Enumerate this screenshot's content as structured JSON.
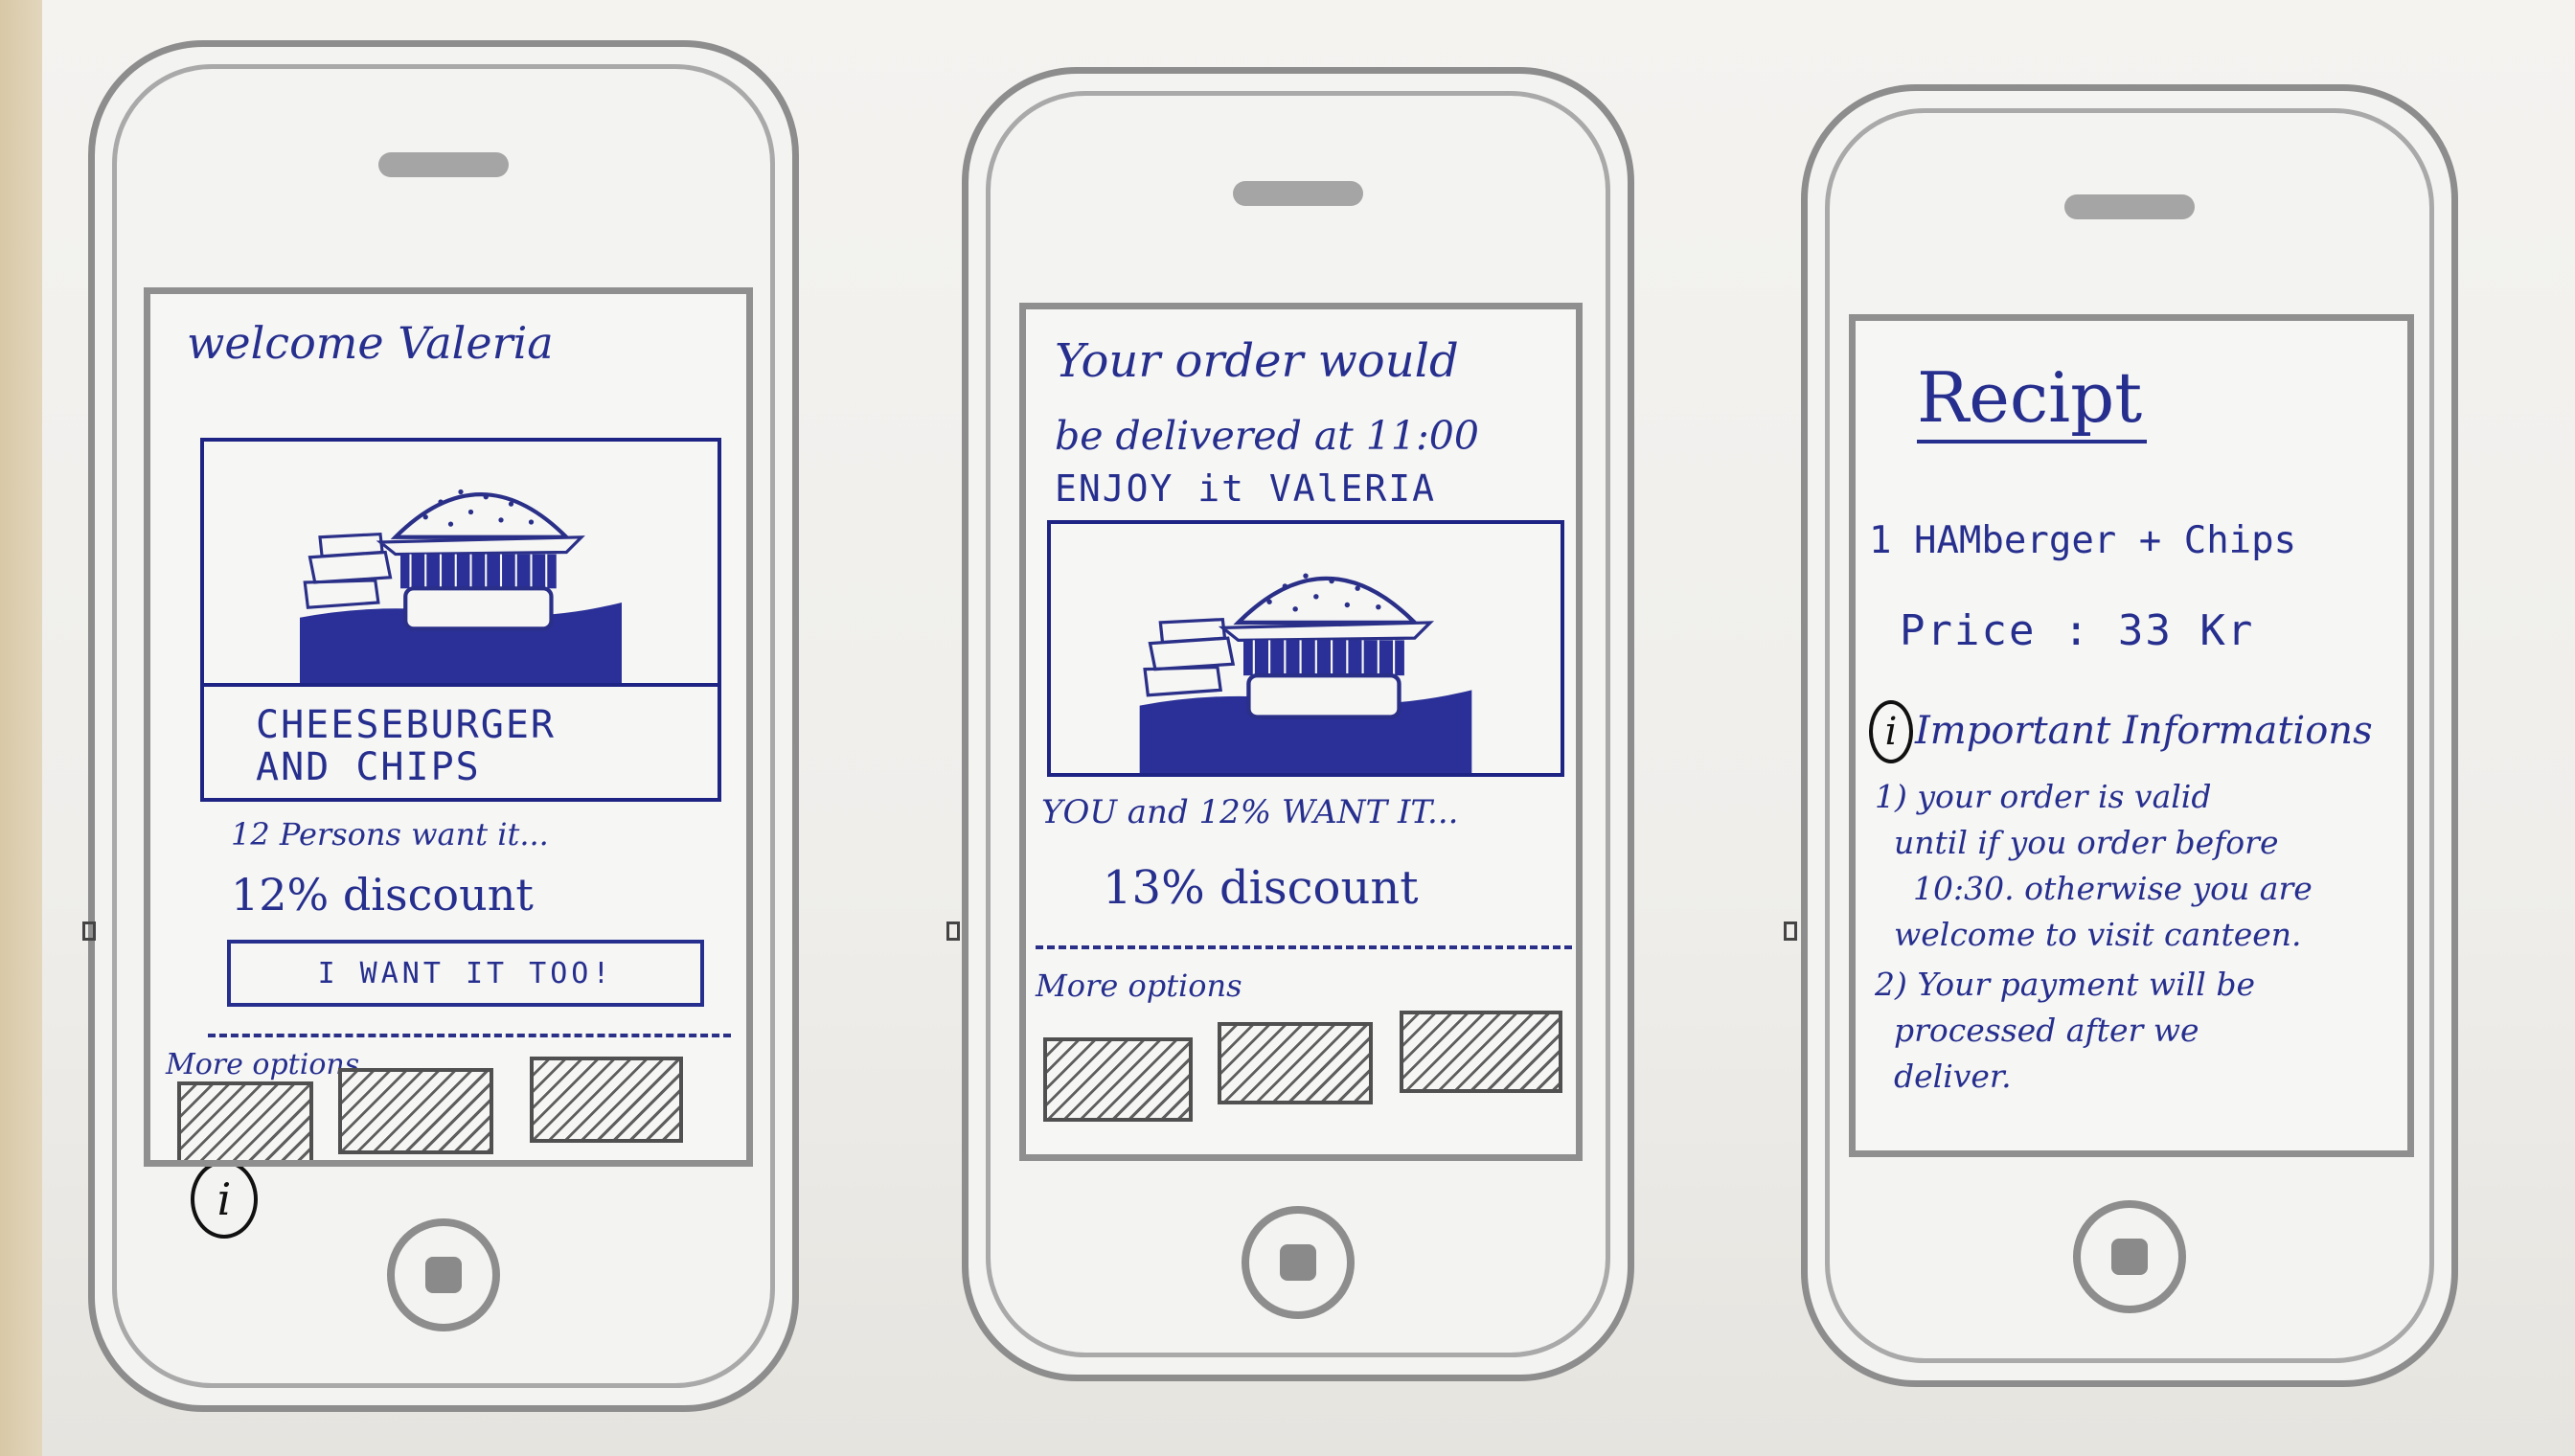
{
  "screen1": {
    "greeting": "welcome Valeria",
    "product_line1": "CHEESEBURGER",
    "product_line2": "AND CHIPS",
    "demand": "12 Persons want it...",
    "discount": "12% discount",
    "cta_button": "I WANT IT TOO!",
    "more_options": "More options",
    "info_icon": "i"
  },
  "screen2": {
    "line1": "Your order would",
    "line2": "be delivered at 11:00",
    "line3": "ENJOY it VAlERIA",
    "demand": "YOU and 12% WANT IT...",
    "discount": "13% discount",
    "more_options": "More options"
  },
  "screen3": {
    "title": "Recipt",
    "item": "1 HAMberger + Chips",
    "price": "Price : 33 Kr",
    "info_heading": "Important Informations",
    "info_icon": "i",
    "note1_line1": "1) your order is valid",
    "note1_line2": "until if you order before",
    "note1_line3": "10:30. otherwise you are",
    "note1_line4": "welcome to visit canteen.",
    "note2_line1": "2) Your payment will be",
    "note2_line2": "processed after we",
    "note2_line3": "deliver."
  },
  "icons": {
    "burger_image": "burger-illustration",
    "option_thumb": "hatched-placeholder",
    "info": "info-circle-icon",
    "home": "home-button-icon"
  },
  "colors": {
    "ink": "#262f8e",
    "device": "#8d8d8d",
    "paper": "#f4f3f0"
  }
}
